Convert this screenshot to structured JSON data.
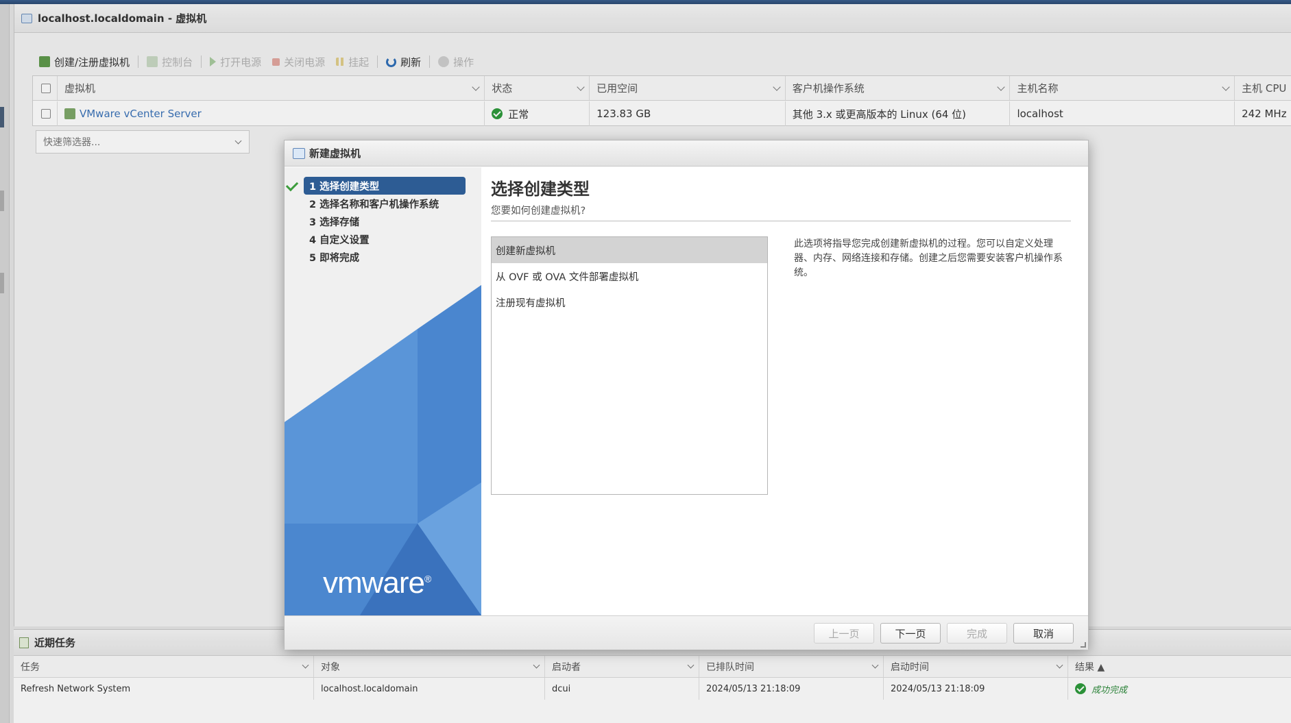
{
  "window": {
    "title": "localhost.localdomain - 虚拟机"
  },
  "toolbar": {
    "create_register": "创建/注册虚拟机",
    "console": "控制台",
    "power_on": "打开电源",
    "power_off": "关闭电源",
    "suspend": "挂起",
    "refresh": "刷新",
    "actions": "操作"
  },
  "vm_grid": {
    "columns": [
      "虚拟机",
      "状态",
      "已用空间",
      "客户机操作系统",
      "主机名称",
      "主机 CPU"
    ],
    "rows": [
      {
        "name": "VMware vCenter Server",
        "status": "正常",
        "used_space": "123.83 GB",
        "guest_os": "其他 3.x 或更高版本的 Linux (64 位)",
        "host_name": "localhost",
        "host_cpu": "242 MHz"
      }
    ]
  },
  "quick_filter": {
    "placeholder": "快速筛选器..."
  },
  "dialog": {
    "title": "新建虚拟机",
    "steps": [
      {
        "label": "1 选择创建类型",
        "active": true,
        "done": true
      },
      {
        "label": "2 选择名称和客户机操作系统"
      },
      {
        "label": "3 选择存储"
      },
      {
        "label": "4 自定义设置"
      },
      {
        "label": "5 即将完成"
      }
    ],
    "heading": "选择创建类型",
    "subheading": "您要如何创建虚拟机?",
    "options": [
      "创建新虚拟机",
      "从 OVF 或 OVA 文件部署虚拟机",
      "注册现有虚拟机"
    ],
    "selected_option": "创建新虚拟机",
    "description": "此选项将指导您完成创建新虚拟机的过程。您可以自定义处理器、内存、网络连接和存储。创建之后您需要安装客户机操作系统。",
    "logo": "vmware",
    "buttons": {
      "back": "上一页",
      "next": "下一页",
      "finish": "完成",
      "cancel": "取消"
    }
  },
  "recent_tasks": {
    "title": "近期任务",
    "columns": [
      "任务",
      "对象",
      "启动者",
      "已排队时间",
      "启动时间",
      "结果 ▲"
    ],
    "rows": [
      {
        "task": "Refresh Network System",
        "target": "localhost.localdomain",
        "initiator": "dcui",
        "queued": "2024/05/13 21:18:09",
        "started": "2024/05/13 21:18:09",
        "result": "成功完成"
      }
    ]
  },
  "colors": {
    "accent": "#2d5c94",
    "success": "#2e9b3c",
    "link": "#3b73b9"
  }
}
